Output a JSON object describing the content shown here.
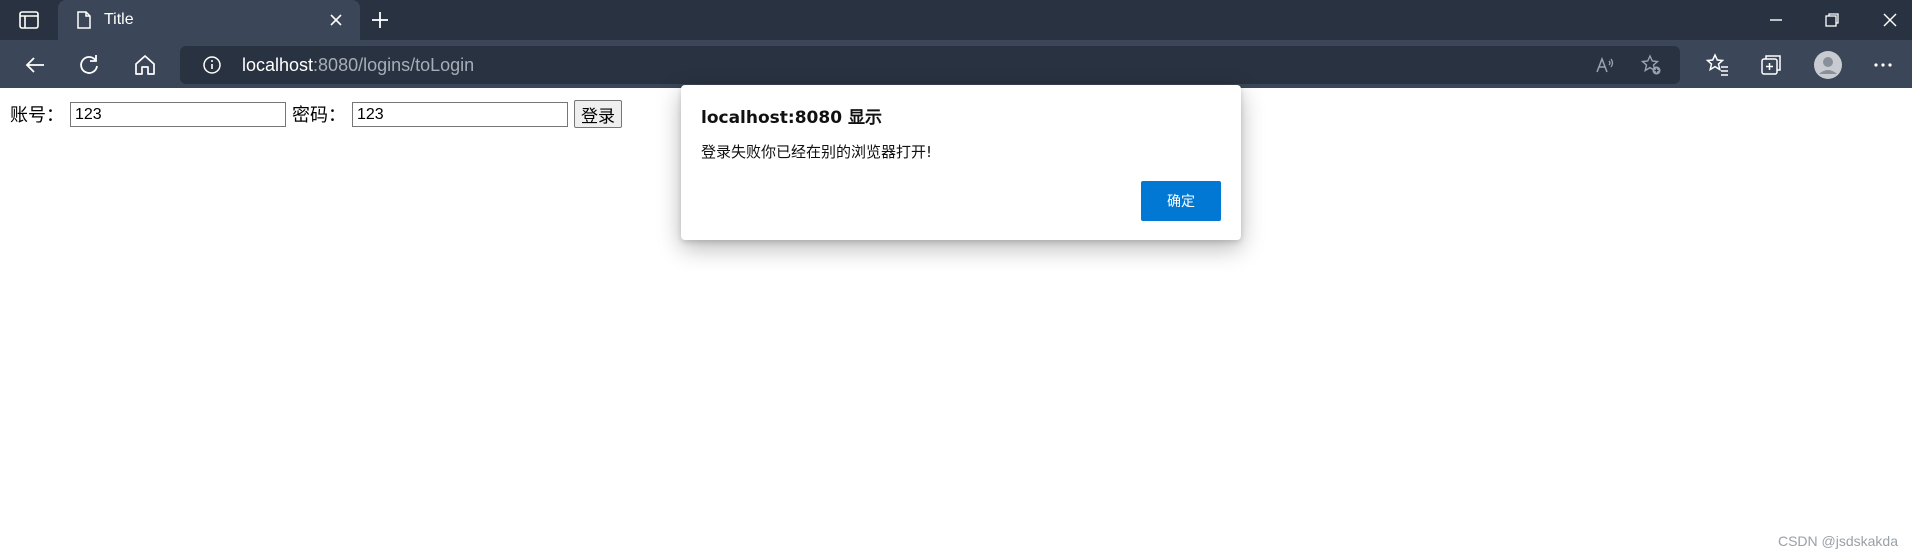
{
  "browser": {
    "tab": {
      "title": "Title"
    },
    "address_bar": {
      "url_host": "localhost",
      "url_rest": ":8080/logins/toLogin"
    }
  },
  "page": {
    "login_form": {
      "account_label": "账号：",
      "account_value": "123",
      "password_label": "密码：",
      "password_value": "123",
      "submit_label": "登录"
    }
  },
  "alert": {
    "title": "localhost:8080 显示",
    "message": "登录失败你已经在别的浏览器打开!",
    "ok_label": "确定"
  },
  "watermark": "CSDN @jsdskakda",
  "colors": {
    "tabstrip": "#293240",
    "toolbar": "#3b4658",
    "primary_button": "#0078d4"
  }
}
